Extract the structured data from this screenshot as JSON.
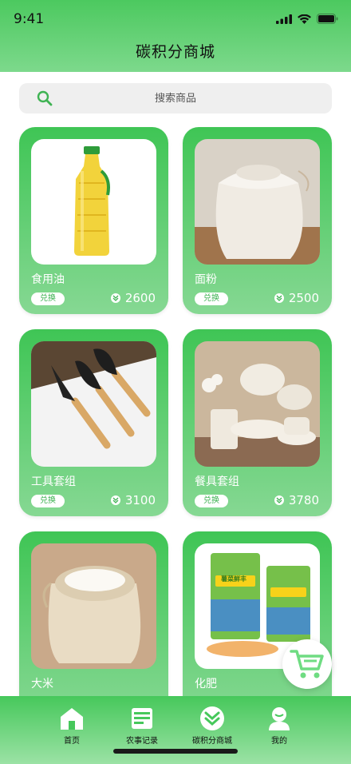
{
  "status": {
    "time": "9:41"
  },
  "header": {
    "title": "碳积分商城"
  },
  "search": {
    "placeholder": "搜索商品"
  },
  "products": [
    {
      "name": "食用油",
      "redeem_label": "兑换",
      "points": "2600"
    },
    {
      "name": "面粉",
      "redeem_label": "兑换",
      "points": "2500"
    },
    {
      "name": "工具套组",
      "redeem_label": "兑换",
      "points": "3100"
    },
    {
      "name": "餐具套组",
      "redeem_label": "兑换",
      "points": "3780"
    },
    {
      "name": "大米"
    },
    {
      "name": "化肥",
      "package_text": "薯菜鲜丰"
    }
  ],
  "tabbar": {
    "items": [
      {
        "label": "首页"
      },
      {
        "label": "农事记录"
      },
      {
        "label": "碳积分商城"
      },
      {
        "label": "我的"
      }
    ]
  },
  "colors": {
    "brand_green": "#3fc555",
    "light_green": "#86d893"
  }
}
